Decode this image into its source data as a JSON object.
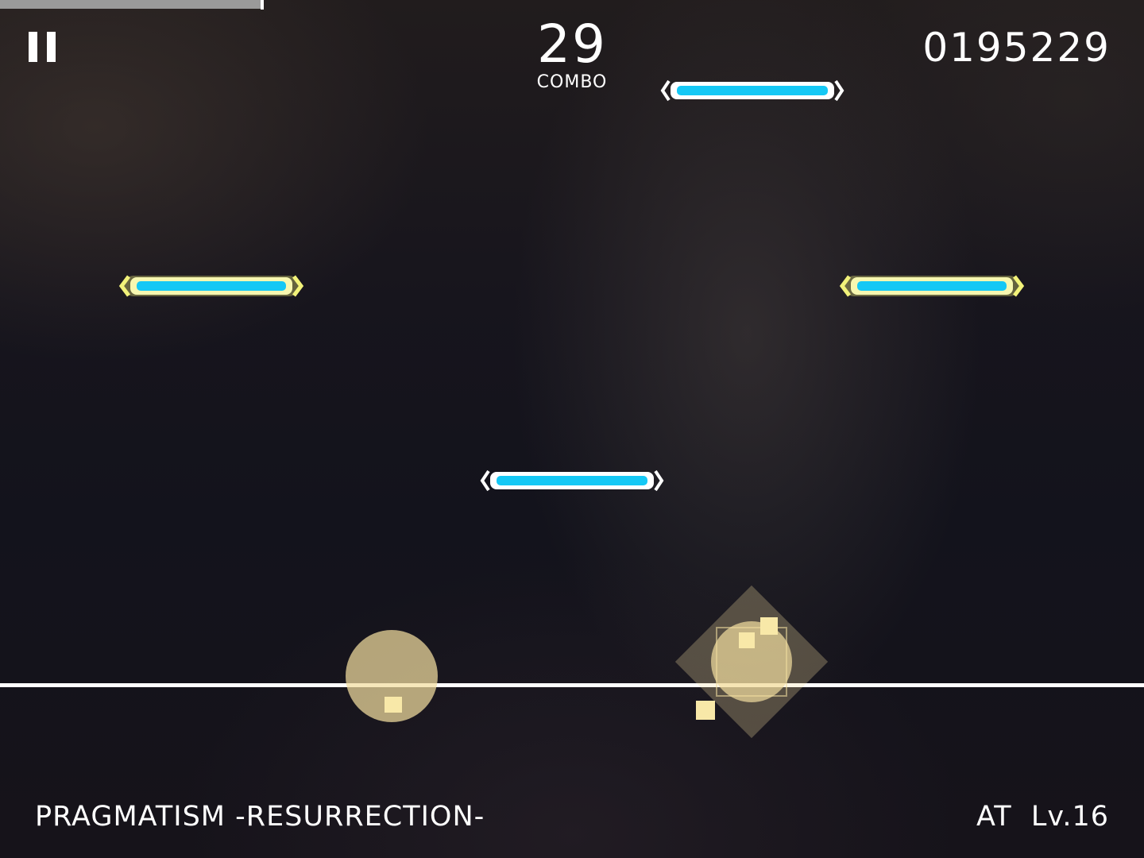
{
  "hud": {
    "progress_fraction": 0.23,
    "combo": "29",
    "combo_label": "COMBO",
    "score": "0195229"
  },
  "song": {
    "title": "PRAGMATISM -RESURRECTION-",
    "difficulty": "AT  Lv.16"
  },
  "colors": {
    "note_fill": "#15c8f5",
    "note_glow_highlight": "#f2f27a",
    "note_border": "#ffffff",
    "hit_effect": "#f3dea0",
    "judge_line": "#ffffff"
  },
  "icons": {
    "pause": "pause-icon"
  }
}
